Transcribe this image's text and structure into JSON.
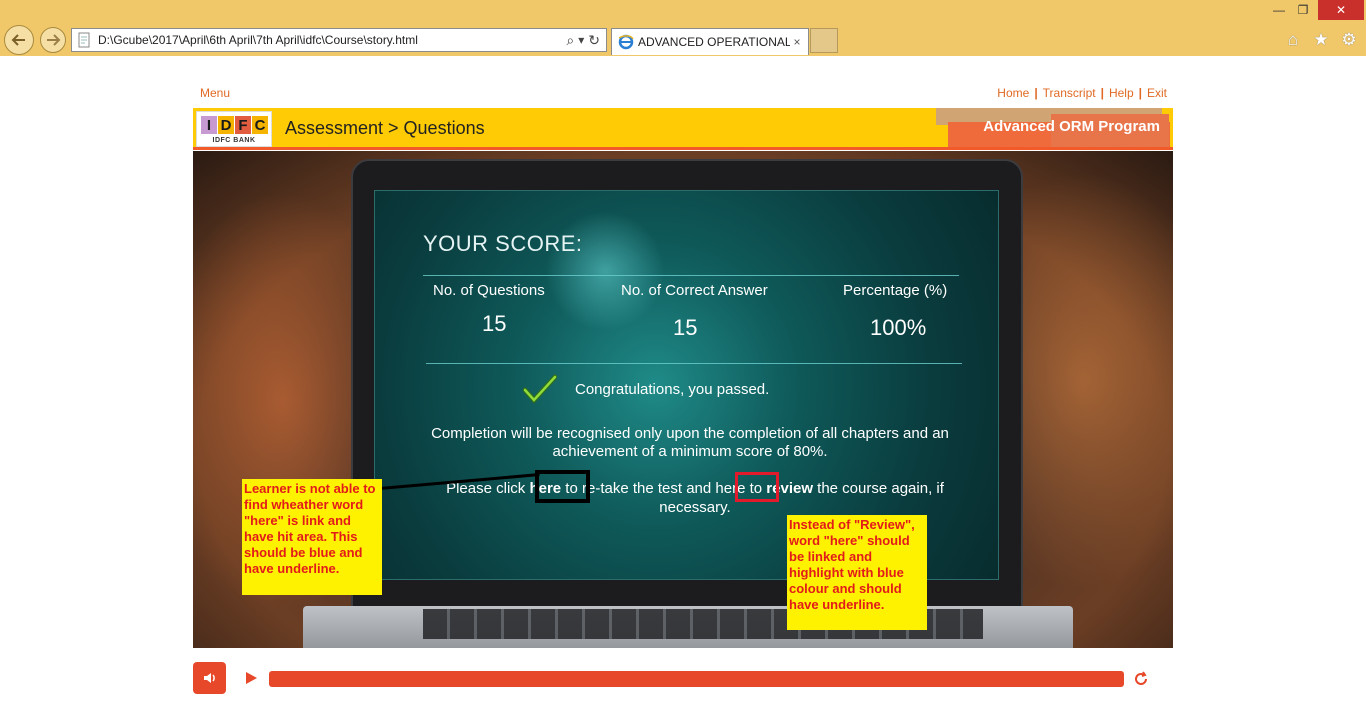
{
  "browser": {
    "url": "D:\\Gcube\\2017\\April\\6th April\\7th April\\idfc\\Course\\story.html",
    "tab_title": "ADVANCED OPERATIONAL...",
    "tab_close": "×",
    "search_glyph": "⌕",
    "dropdown_glyph": "▾",
    "refresh_glyph": "↻",
    "window_controls": {
      "minimize": "—",
      "restore": "❐",
      "close": "✕"
    },
    "right_icons": {
      "home": "⌂",
      "favorites": "★",
      "settings": "⚙"
    }
  },
  "course_nav": {
    "menu": "Menu",
    "links": [
      "Home",
      "Transcript",
      "Help",
      "Exit"
    ],
    "separator": "|"
  },
  "banner": {
    "logo_letters": [
      "I",
      "D",
      "F",
      "C"
    ],
    "logo_colors": [
      "#c79ad1",
      "#f4b400",
      "#e25c3f",
      "#f4b400"
    ],
    "logo_sub": "IDFC BANK",
    "breadcrumb": "Assessment > Questions",
    "program": "Advanced ORM Program"
  },
  "score": {
    "title": "YOUR SCORE:",
    "columns": [
      {
        "label": "No. of Questions",
        "value": "15"
      },
      {
        "label": "No. of Correct Answer",
        "value": "15"
      },
      {
        "label": "Percentage (%)",
        "value": "100%"
      }
    ],
    "congrats": "Congratulations, you passed.",
    "completion_note": "Completion will be recognised only upon the completion of all chapters and an achievement of a minimum score of 80%.",
    "retake_prefix": "Please click ",
    "retake_link": "here",
    "retake_middle": " to re-take the test and ",
    "review_link": "here",
    "review_middle": " to ",
    "review_word": "review",
    "review_suffix": " the course again, if necessary."
  },
  "annotations": {
    "left_callout": "Learner is not able to find wheather word \"here\" is link and have hit area. This should be blue and have underline.",
    "right_callout": "Instead of \"Review\", word \"here\" should be linked and highlight with blue colour and should have underline."
  },
  "colors": {
    "accent_orange": "#e8482a",
    "banner_yellow": "#ffcb05",
    "annotation_yellow": "#fff200",
    "annotation_red": "#e21b1b"
  }
}
